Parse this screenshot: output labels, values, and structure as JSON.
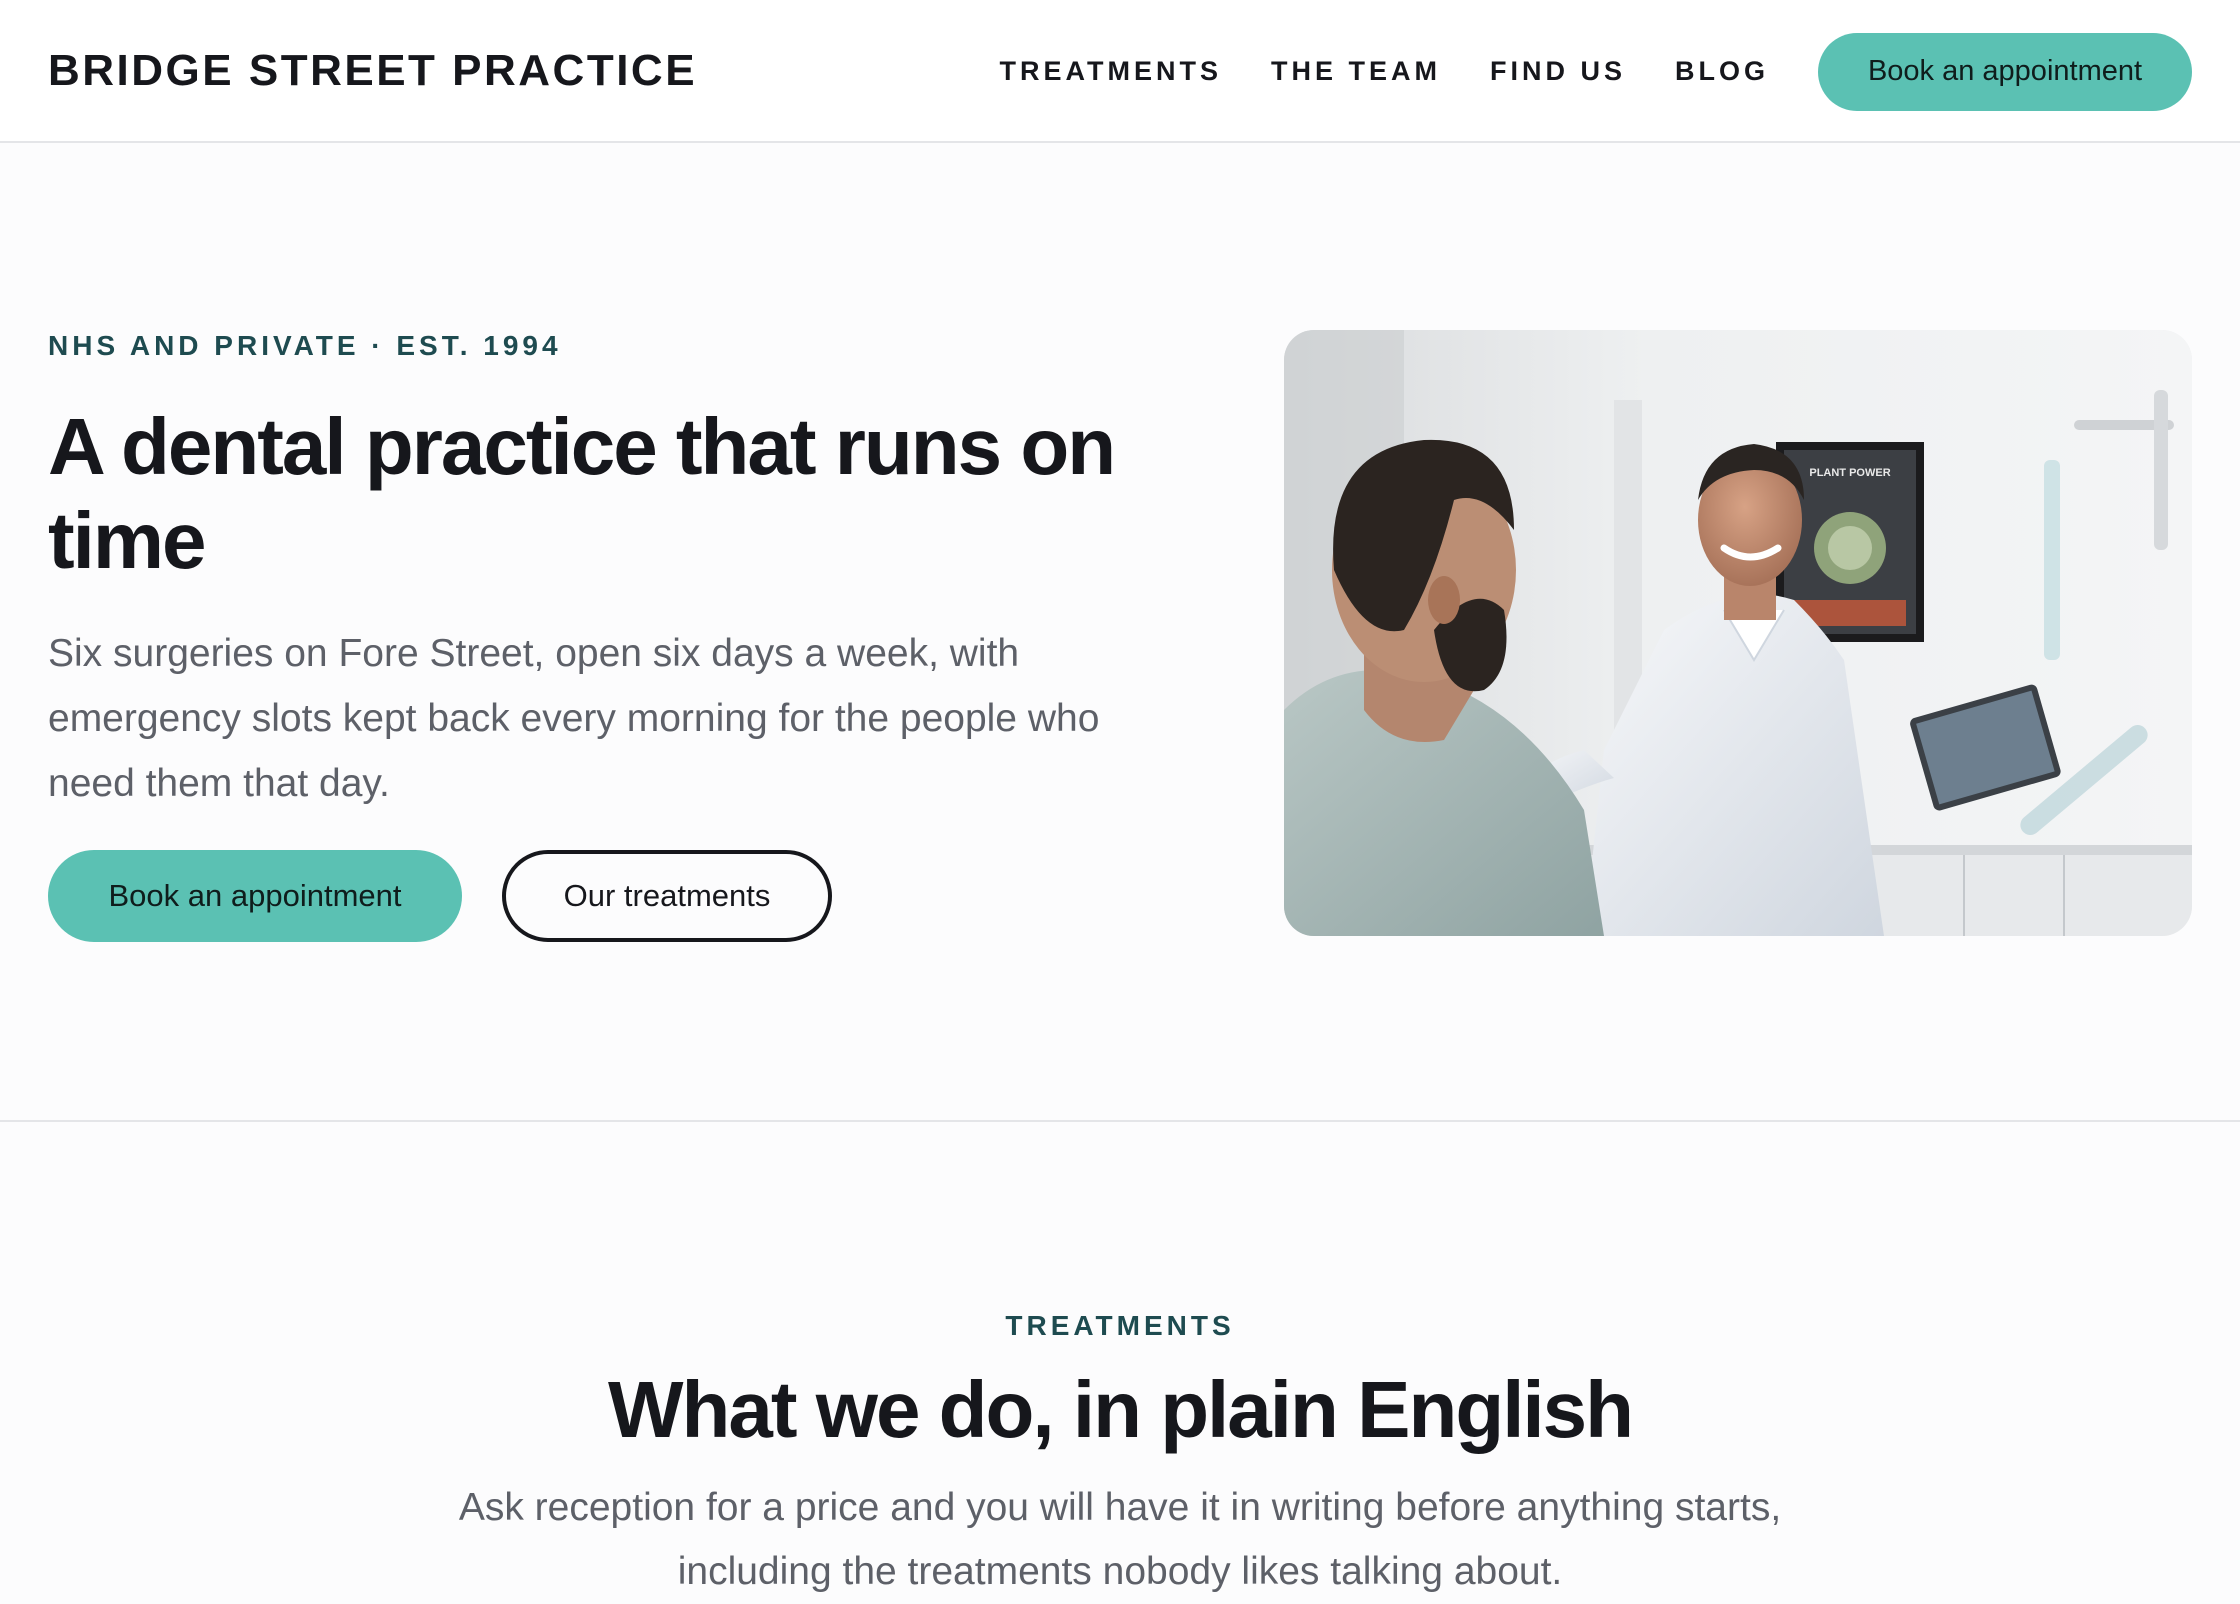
{
  "header": {
    "brand": "BRIDGE STREET PRACTICE",
    "nav": [
      {
        "label": "TREATMENTS"
      },
      {
        "label": "THE TEAM"
      },
      {
        "label": "FIND US"
      },
      {
        "label": "BLOG"
      }
    ],
    "cta_label": "Book an appointment"
  },
  "hero": {
    "eyebrow": "NHS AND PRIVATE · EST. 1994",
    "title": "A dental practice that runs on time",
    "text": "Six surgeries on Fore Street, open six days a week, with emergency slots kept back every morning for the people who need them that day.",
    "primary_button": "Book an appointment",
    "secondary_button": "Our treatments",
    "image_poster_text": "PLANT POWER"
  },
  "treatments": {
    "eyebrow": "TREATMENTS",
    "title": "What we do, in plain English",
    "text": "Ask reception for a price and you will have it in writing before anything starts, including the treatments nobody likes talking about."
  },
  "colors": {
    "accent": "#5bc1b3",
    "eyebrow": "#1e4b50",
    "text": "#16171c",
    "muted": "#5d6068",
    "divider": "#e4e5e8"
  }
}
